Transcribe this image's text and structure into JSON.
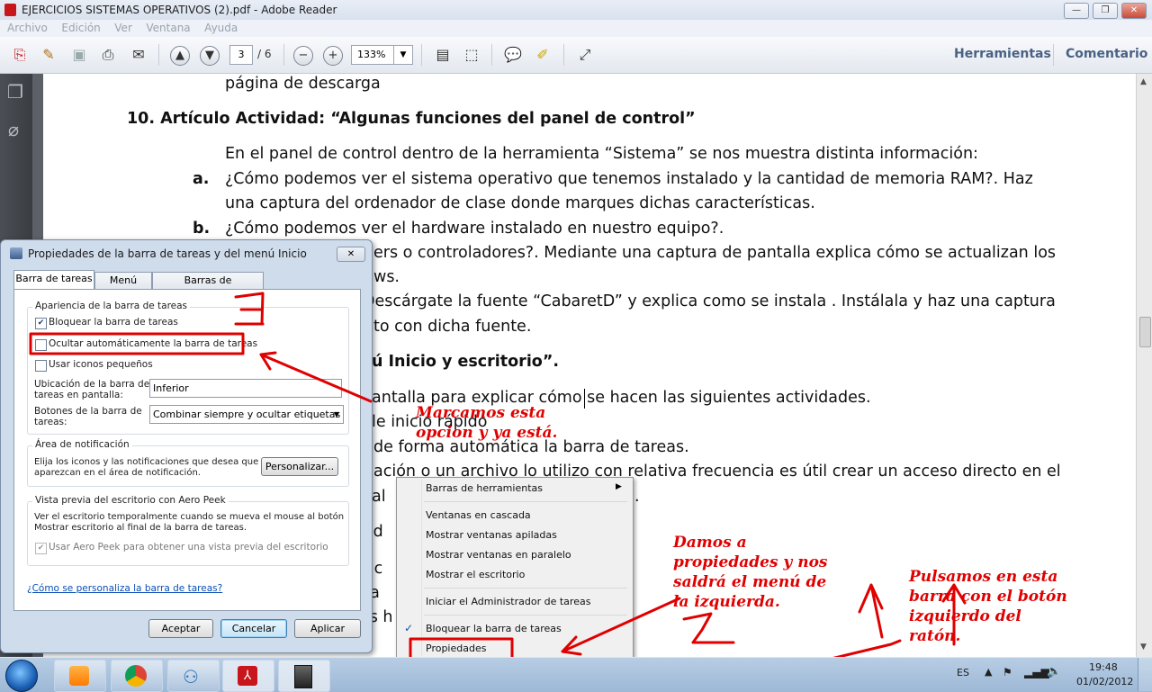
{
  "window": {
    "title": "EJERCICIOS SISTEMAS OPERATIVOS (2).pdf - Adobe Reader",
    "menu": [
      "Archivo",
      "Edición",
      "Ver",
      "Ventana",
      "Ayuda"
    ]
  },
  "toolbar": {
    "page_current": "3",
    "page_total": "/ 6",
    "zoom": "133%",
    "herramientas": "Herramientas",
    "comentario": "Comentario"
  },
  "document": {
    "lines": [
      "página de descarga",
      "10.  Artículo Actividad: “Algunas funciones del panel de control”",
      "En el panel de control dentro de la herramienta “Sistema” se nos muestra distinta información:",
      "a.",
      "¿Cómo podemos ver el sistema operativo que tenemos instalado y la cantidad de memoria RAM?. Haz",
      "una captura del ordenador de clase donde marques dichas características.",
      "b.",
      "¿Cómo podemos ver el hardware instalado en nuestro equipo?.",
      "ers o controladores?. Mediante una captura de pantalla explica cómo se actualizan los",
      "ws.",
      "Descárgate la fuente “CabaretD” y explica como se instala . Instálala y haz una captura",
      "to con dicha fuente.",
      "ú Inicio y escritorio”.",
      "antalla para explicar cómo se hacen las siguientes actividades.",
      "le inicio rápido",
      "de forma automática la barra de tareas.",
      "ación o un archivo lo utilizo con relativa frecuencia es útil crear un acceso directo en el",
      "al",
      ".",
      "s d",
      "ajc",
      "na",
      "as h"
    ]
  },
  "dialog": {
    "title": "Propiedades de la barra de tareas y del menú Inicio",
    "tabs": [
      "Barra de tareas",
      "Menú Inicio",
      "Barras de herramientas"
    ],
    "group_apariencia": "Apariencia de la barra de tareas",
    "chk_bloquear": "Bloquear la barra de tareas",
    "chk_ocultar": "Ocultar automáticamente la barra de tareas",
    "chk_iconos": "Usar iconos pequeños",
    "ubicacion_label_1": "Ubicación de la barra de",
    "ubicacion_label_2": "tareas en pantalla:",
    "ubicacion_value": "Inferior",
    "botones_label_1": "Botones de la barra de",
    "botones_label_2": "tareas:",
    "botones_value": "Combinar siempre y ocultar etiquetas",
    "group_notif": "Área de notificación",
    "notif_text_1": "Elija los iconos y las notificaciones que desea que",
    "notif_text_2": "aparezcan en el área de notificación.",
    "personalizar": "Personalizar...",
    "group_aero": "Vista previa del escritorio con Aero Peek",
    "aero_text_1": "Ver el escritorio temporalmente cuando se mueva el mouse al botón",
    "aero_text_2": "Mostrar escritorio al final de la barra de tareas.",
    "chk_aero": "Usar Aero Peek para obtener una vista previa del escritorio",
    "help_link": "¿Cómo se personaliza la barra de tareas?",
    "btn_aceptar": "Aceptar",
    "btn_cancelar": "Cancelar",
    "btn_aplicar": "Aplicar"
  },
  "context_menu": {
    "items": [
      "Barras de herramientas",
      "Ventanas en cascada",
      "Mostrar ventanas apiladas",
      "Mostrar ventanas en paralelo",
      "Mostrar el escritorio",
      "Iniciar el Administrador de tareas",
      "Bloquear la barra de tareas",
      "Propiedades"
    ]
  },
  "annotations": {
    "marcamos": [
      "Marcamos esta",
      "opcion y ya está."
    ],
    "damos": [
      "Damos a",
      "propiedades y nos",
      "saldrá el menú de",
      "la izquierda."
    ],
    "pulsamos": [
      "Pulsamos en esta",
      "barra con el botón",
      "izquierdo del",
      "ratón."
    ],
    "numeral_3": "3",
    "numeral_2": "2"
  },
  "tray": {
    "lang": "ES",
    "time": "19:48",
    "date": "01/02/2012"
  },
  "colors": {
    "annotation": "#e00000",
    "taskbar": "#a9c2de",
    "dialog_frame": "#cfdceb"
  }
}
